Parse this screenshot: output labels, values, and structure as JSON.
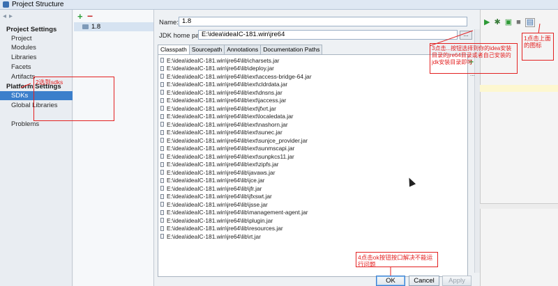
{
  "window": {
    "title": "Project Structure"
  },
  "nav": {
    "project_settings_header": "Project Settings",
    "project_settings": [
      "Project",
      "Modules",
      "Libraries",
      "Facets",
      "Artifacts"
    ],
    "platform_settings_header": "Platform Settings",
    "platform_settings": [
      "SDKs",
      "Global Libraries"
    ],
    "problems": "Problems",
    "selected": "SDKs"
  },
  "sdk_list": {
    "add": "+",
    "remove": "−",
    "items": [
      "1.8"
    ]
  },
  "detail": {
    "name_label": "Name:",
    "name_value": "1.8",
    "home_label": "JDK home path:",
    "home_value": "E:\\idea\\ideaIC-181.win\\jre64",
    "browse_label": "...",
    "tabs": [
      "Classpath",
      "Sourcepath",
      "Annotations",
      "Documentation Paths"
    ],
    "active_tab": "Classpath",
    "side_add": "+",
    "side_more": "...",
    "classpath": [
      "E:\\idea\\ideaIC-181.win\\jre64\\lib\\charsets.jar",
      "E:\\idea\\ideaIC-181.win\\jre64\\lib\\deploy.jar",
      "E:\\idea\\ideaIC-181.win\\jre64\\lib\\ext\\access-bridge-64.jar",
      "E:\\idea\\ideaIC-181.win\\jre64\\lib\\ext\\cldrdata.jar",
      "E:\\idea\\ideaIC-181.win\\jre64\\lib\\ext\\dnsns.jar",
      "E:\\idea\\ideaIC-181.win\\jre64\\lib\\ext\\jaccess.jar",
      "E:\\idea\\ideaIC-181.win\\jre64\\lib\\ext\\jfxrt.jar",
      "E:\\idea\\ideaIC-181.win\\jre64\\lib\\ext\\localedata.jar",
      "E:\\idea\\ideaIC-181.win\\jre64\\lib\\ext\\nashorn.jar",
      "E:\\idea\\ideaIC-181.win\\jre64\\lib\\ext\\sunec.jar",
      "E:\\idea\\ideaIC-181.win\\jre64\\lib\\ext\\sunjce_provider.jar",
      "E:\\idea\\ideaIC-181.win\\jre64\\lib\\ext\\sunmscapi.jar",
      "E:\\idea\\ideaIC-181.win\\jre64\\lib\\ext\\sunpkcs11.jar",
      "E:\\idea\\ideaIC-181.win\\jre64\\lib\\ext\\zipfs.jar",
      "E:\\idea\\ideaIC-181.win\\jre64\\lib\\javaws.jar",
      "E:\\idea\\ideaIC-181.win\\jre64\\lib\\jce.jar",
      "E:\\idea\\ideaIC-181.win\\jre64\\lib\\jfr.jar",
      "E:\\idea\\ideaIC-181.win\\jre64\\lib\\jfxswt.jar",
      "E:\\idea\\ideaIC-181.win\\jre64\\lib\\jsse.jar",
      "E:\\idea\\ideaIC-181.win\\jre64\\lib\\management-agent.jar",
      "E:\\idea\\ideaIC-181.win\\jre64\\lib\\plugin.jar",
      "E:\\idea\\ideaIC-181.win\\jre64\\lib\\resources.jar",
      "E:\\idea\\ideaIC-181.win\\jre64\\lib\\rt.jar"
    ]
  },
  "buttons": {
    "ok": "OK",
    "cancel": "Cancel",
    "apply": "Apply"
  },
  "annotations": {
    "a1": "1点击上面的图标",
    "a2": "2选到sdks",
    "a3": "3点击...按钮选择到你的idea安装目录的jre64目录或者自己安装的jdk安装目录即可",
    "a4": "4点击ok按钮按口解决不能运行问题"
  },
  "colors": {
    "accent": "#3b7fcb",
    "annotation": "#e32020",
    "add": "#2f9e3a",
    "remove": "#c62828"
  }
}
